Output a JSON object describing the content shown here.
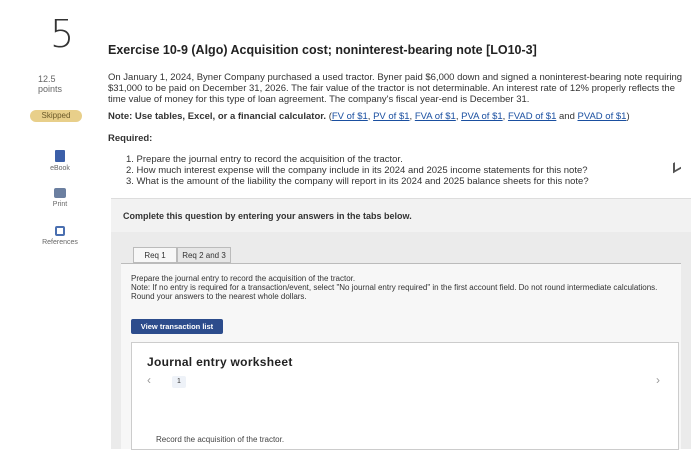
{
  "question": {
    "number": "5",
    "points_value": "12.5",
    "points_label": "points",
    "status": "Skipped"
  },
  "rail": {
    "ebook": "eBook",
    "print": "Print",
    "references": "References"
  },
  "exercise": {
    "title": "Exercise 10-9 (Algo) Acquisition cost; noninterest-bearing note [LO10-3]",
    "intro": "On January 1, 2024, Byner Company purchased a used tractor. Byner paid $6,000 down and signed a noninterest-bearing note requiring $31,000 to be paid on December 31, 2026. The fair value of the tractor is not determinable. An interest rate of 12% properly reflects the time value of money for this type of loan agreement. The company's fiscal year-end is December 31.",
    "note_label": "Note: Use tables, Excel, or a financial calculator.",
    "links": [
      "FV of $1",
      "PV of $1",
      "FVA of $1",
      "PVA of $1",
      "FVAD of $1",
      "PVAD of $1"
    ],
    "required_label": "Required:",
    "requirements": [
      "1. Prepare the journal entry to record the acquisition of the tractor.",
      "2. How much interest expense will the company include in its 2024 and 2025 income statements for this note?",
      "3. What is the amount of the liability the company will report in its 2024 and 2025 balance sheets for this note?"
    ]
  },
  "panel": {
    "header": "Complete this question by entering your answers in the tabs below.",
    "tabs": [
      "Req 1",
      "Req 2 and 3"
    ],
    "instruction_main": "Prepare the journal entry to record the acquisition of the tractor.",
    "instruction_note": "Note: If no entry is required for a transaction/event, select \"No journal entry required\" in the first account field. Do not round intermediate calculations. Round your answers to the nearest whole dollars.",
    "view_button": "View transaction list",
    "worksheet_title": "Journal entry worksheet",
    "page_num": "1",
    "caption": "Record the acquisition of the tractor."
  }
}
